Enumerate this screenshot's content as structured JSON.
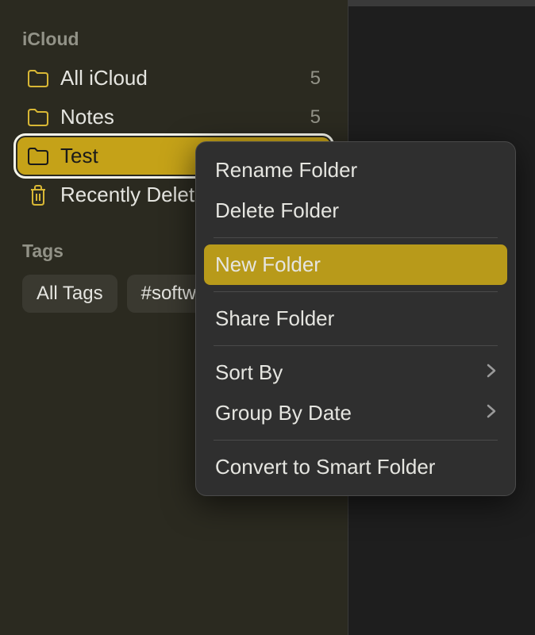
{
  "sidebar": {
    "section_label": "iCloud",
    "items": [
      {
        "label": "All iCloud",
        "count": "5",
        "type": "folder"
      },
      {
        "label": "Notes",
        "count": "5",
        "type": "folder"
      },
      {
        "label": "Test",
        "count": "",
        "type": "folder",
        "selected": true
      },
      {
        "label": "Recently Deleted",
        "count": "",
        "type": "trash"
      }
    ],
    "tags_label": "Tags",
    "tags": [
      {
        "label": "All Tags"
      },
      {
        "label": "#software"
      }
    ]
  },
  "context_menu": {
    "items": [
      {
        "label": "Rename Folder"
      },
      {
        "label": "Delete Folder"
      },
      {
        "sep": true
      },
      {
        "label": "New Folder",
        "highlighted": true
      },
      {
        "sep": true
      },
      {
        "label": "Share Folder"
      },
      {
        "sep": true
      },
      {
        "label": "Sort By",
        "submenu": true
      },
      {
        "label": "Group By Date",
        "submenu": true
      },
      {
        "sep": true
      },
      {
        "label": "Convert to Smart Folder"
      }
    ]
  }
}
